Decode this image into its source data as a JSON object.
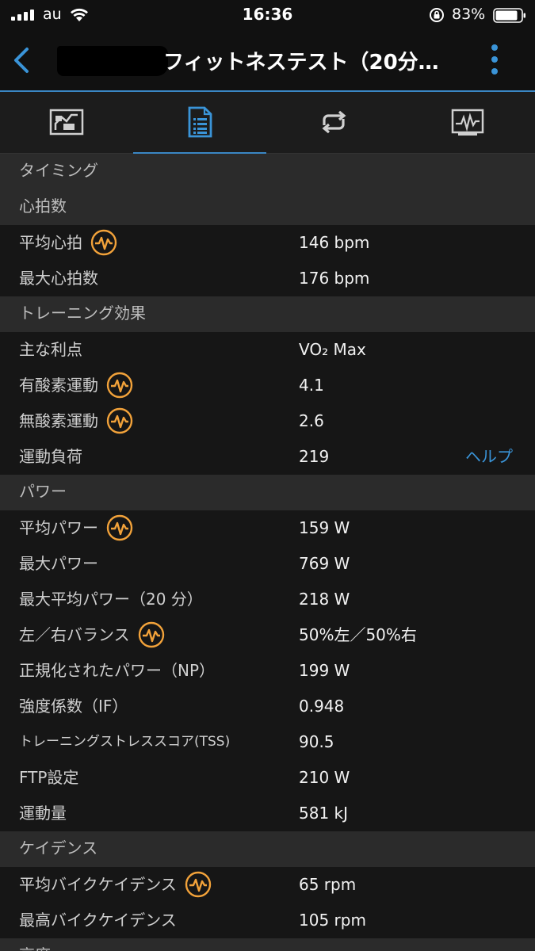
{
  "status_bar": {
    "carrier": "au",
    "time": "16:36",
    "battery_percent": "83%"
  },
  "header": {
    "title": "フィットネステスト（20分…"
  },
  "tabs": [
    {
      "name": "summary-tab",
      "icon": "map-icon"
    },
    {
      "name": "details-tab",
      "icon": "document-list-icon",
      "active": true
    },
    {
      "name": "laps-tab",
      "icon": "repeat-icon"
    },
    {
      "name": "charts-tab",
      "icon": "chart-icon"
    }
  ],
  "sections": {
    "timing": "タイミング",
    "heart_rate": "心拍数",
    "training_effect": "トレーニング効果",
    "power": "パワー",
    "cadence": "ケイデンス",
    "elevation": "高度"
  },
  "heart_rate": {
    "avg_label": "平均心拍",
    "avg_value": "146 bpm",
    "max_label": "最大心拍数",
    "max_value": "176 bpm"
  },
  "training_effect": {
    "primary_label": "主な利点",
    "primary_value": "VO₂ Max",
    "aerobic_label": "有酸素運動",
    "aerobic_value": "4.1",
    "anaerobic_label": "無酸素運動",
    "anaerobic_value": "2.6",
    "load_label": "運動負荷",
    "load_value": "219",
    "help_link": "ヘルプ"
  },
  "power": {
    "avg_label": "平均パワー",
    "avg_value": "159 W",
    "max_label": "最大パワー",
    "max_value": "769 W",
    "max_avg20_label": "最大平均パワー（20 分）",
    "max_avg20_value": "218 W",
    "balance_label": "左／右バランス",
    "balance_value": "50%左／50%右",
    "np_label": "正規化されたパワー（NP）",
    "np_value": "199 W",
    "if_label": "強度係数（IF）",
    "if_value": "0.948",
    "tss_label": "トレーニングストレススコア(TSS)",
    "tss_value": "90.5",
    "ftp_label": "FTP設定",
    "ftp_value": "210 W",
    "work_label": "運動量",
    "work_value": "581 kJ"
  },
  "cadence": {
    "avg_label": "平均バイクケイデンス",
    "avg_value": "65 rpm",
    "max_label": "最高バイクケイデンス",
    "max_value": "105 rpm"
  },
  "colors": {
    "accent_blue": "#3a87c4",
    "premium_orange": "#f2a23a"
  }
}
